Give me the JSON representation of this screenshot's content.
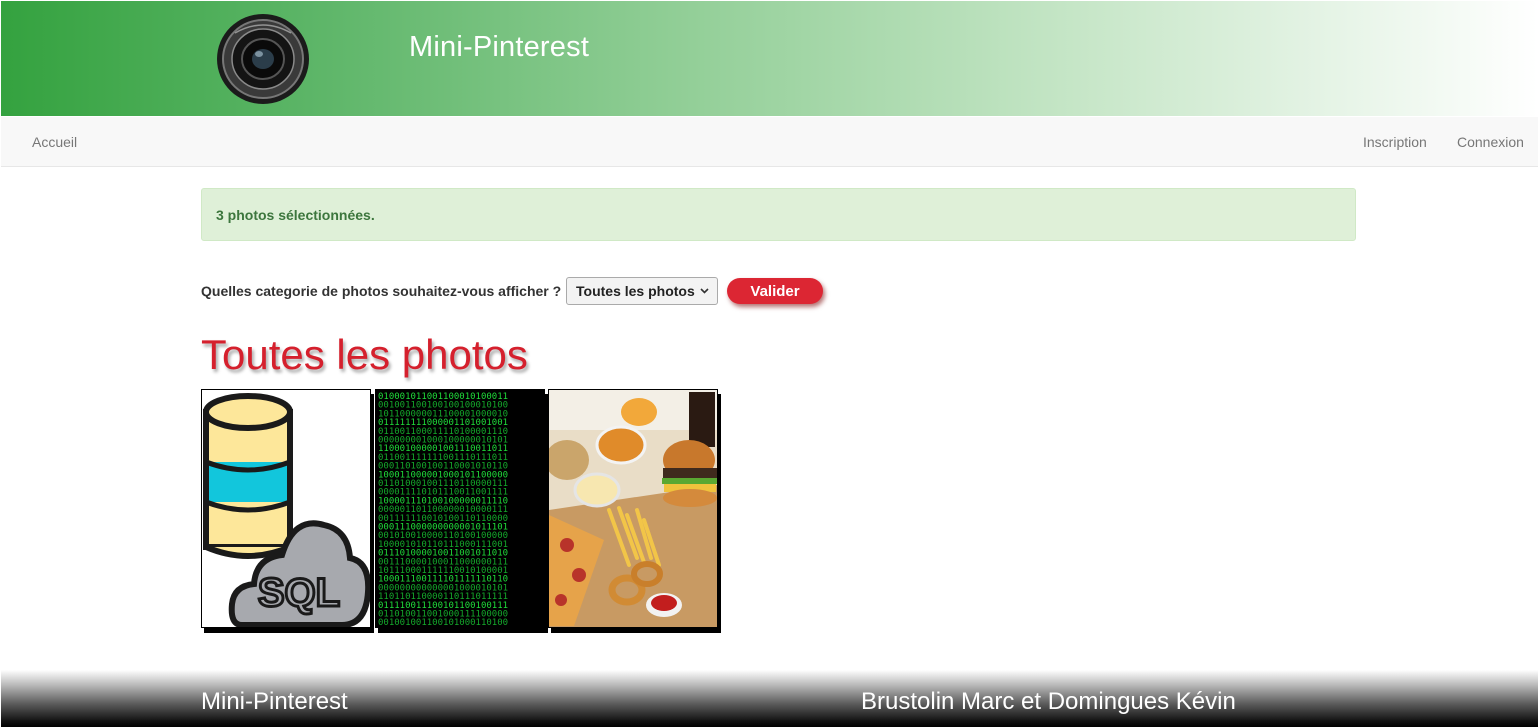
{
  "header": {
    "logo_icon": "camera-lens-icon",
    "title": "Mini-Pinterest"
  },
  "navbar": {
    "home": "Accueil",
    "register": "Inscription",
    "login": "Connexion"
  },
  "alert": {
    "message": "3 photos sélectionnées."
  },
  "filter": {
    "label": "Quelles categorie de photos souhaitez-vous afficher ?",
    "selected": "Toutes les photos",
    "submit_label": "Valider"
  },
  "gallery": {
    "heading": "Toutes les photos",
    "photos": [
      {
        "subject": "sql-database-cloud-icon",
        "caption": "SQL"
      },
      {
        "subject": "binary-code-image"
      },
      {
        "subject": "fast-food-image"
      }
    ]
  },
  "footer": {
    "left": "Mini-Pinterest",
    "right": "Brustolin Marc et Domingues Kévin"
  },
  "colors": {
    "accent_red": "#d5202d",
    "header_green": "#34a23f",
    "alert_bg": "#dff0d8",
    "alert_text": "#3c763d"
  }
}
